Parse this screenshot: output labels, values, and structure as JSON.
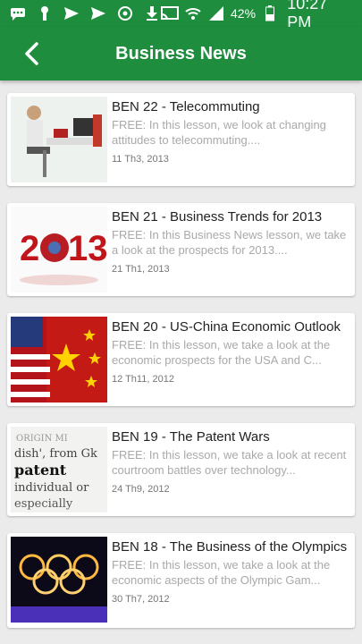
{
  "status_bar": {
    "icons": [
      "message-icon",
      "keyhole-icon",
      "send-icon",
      "send-icon",
      "sync-icon",
      "download-icon",
      "cast-icon",
      "wifi-icon",
      "signal-icon",
      "battery-icon"
    ],
    "battery": "42%",
    "time": "10:27 PM"
  },
  "app_bar": {
    "title": "Business News",
    "back_icon": "chevron-left-icon"
  },
  "articles": [
    {
      "title": "BEN 22 - Telecommuting",
      "description": "FREE: In this lesson, we look at changing attitudes to telecommuting....",
      "date": "11 Th3, 2013",
      "thumb": "woman-at-desk-photo"
    },
    {
      "title": "BEN 21 - Business Trends for 2013",
      "description": "FREE: In this Business News lesson, we take a look at the prospects for 2013....",
      "date": "21 Th1, 2013",
      "thumb": "3d-2013-photo"
    },
    {
      "title": "BEN 20 - US-China Economic Outlook",
      "description": "FREE: In this lesson, we take a look at the economic prospects for the USA and C...",
      "date": "12 Th11, 2012",
      "thumb": "us-china-flags-photo"
    },
    {
      "title": "BEN 19 - The Patent Wars",
      "description": "FREE: In this lesson, we take a look at recent courtroom battles over technology...",
      "date": "24 Th9, 2012",
      "thumb": "dictionary-patent-photo"
    },
    {
      "title": "BEN 18 - The Business of the Olympics",
      "description": "FREE: In this  lesson, we take a look at the economic aspects of the Olympic Gam...",
      "date": "30 Th7, 2012",
      "thumb": "olympic-rings-fireworks-photo"
    }
  ]
}
